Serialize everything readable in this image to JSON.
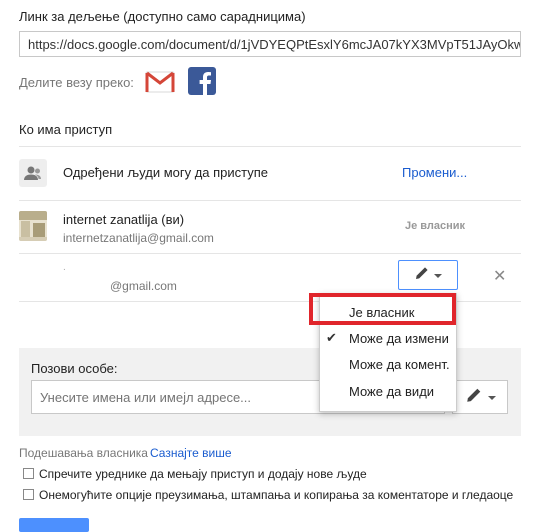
{
  "share_link": {
    "label": "Линк за дељење (доступно само сарадницима)",
    "url": "https://docs.google.com/document/d/1jVDYEQPtEsxlY6mcJA07kYX3MVpT51JAyOkw"
  },
  "share_via": {
    "label": "Делите везу преко:",
    "services": [
      {
        "name": "Gmail",
        "icon": "gmail-icon"
      },
      {
        "name": "Facebook",
        "icon": "facebook-icon"
      }
    ]
  },
  "access": {
    "title": "Ко има приступ",
    "general": {
      "text": "Одређени људи могу да приступе",
      "change_link": "Промени..."
    },
    "people": [
      {
        "name": "internet zanatlija (ви)",
        "email": "internetzanatlija@gmail.com",
        "role": "Је власник"
      },
      {
        "name": ".",
        "email": "@gmail.com"
      }
    ]
  },
  "invite": {
    "label": "Позови особе:",
    "placeholder": "Унесите имена или имејл адресе..."
  },
  "permission_menu": {
    "items": [
      {
        "label": "Је власник",
        "checked": false,
        "highlighted": true
      },
      {
        "label": "Може да измени",
        "checked": true
      },
      {
        "label": "Може да комент.",
        "checked": false
      },
      {
        "label": "Може да види",
        "checked": false
      }
    ]
  },
  "owner_settings": {
    "label": "Подешавања власника",
    "learn_more": "Сазнајте више",
    "options": [
      {
        "label": "Спречите уреднике да мењају приступ и додају нове људе",
        "checked": false
      },
      {
        "label": "Онемогућите опције преузимања, штампања и копирања за коментаторе и гледаоце",
        "checked": false
      }
    ]
  },
  "colors": {
    "link": "#1a5ccf",
    "highlight": "#e0252b",
    "accent": "#4d90fe"
  }
}
